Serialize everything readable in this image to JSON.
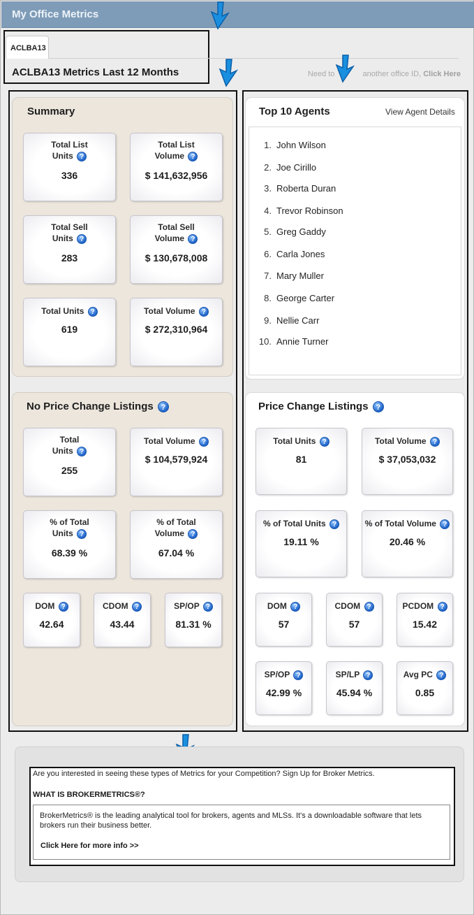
{
  "window": {
    "title": "My Office Metrics"
  },
  "tabs": [
    {
      "label": "ACLBA13"
    }
  ],
  "office": {
    "title": "ACLBA13 Metrics Last 12 Months",
    "change_prompt": "Need to",
    "change_prompt_tail": "another office ID,",
    "change_link": "Click Here"
  },
  "summary": {
    "title": "Summary",
    "cards": [
      {
        "label1": "Total List",
        "label2": "Units",
        "value": "336"
      },
      {
        "label1": "Total List",
        "label2": "Volume",
        "value": "$ 141,632,956"
      },
      {
        "label1": "Total Sell",
        "label2": "Units",
        "value": "283"
      },
      {
        "label1": "Total Sell",
        "label2": "Volume",
        "value": "$ 130,678,008"
      },
      {
        "label1": "Total Units",
        "value": "619"
      },
      {
        "label1": "Total Volume",
        "value": "$ 272,310,964"
      }
    ]
  },
  "top_agents": {
    "title": "Top 10 Agents",
    "link": "View Agent Details",
    "agents": [
      {
        "rank": "1.",
        "name": "John Wilson"
      },
      {
        "rank": "2.",
        "name": "Joe Cirillo"
      },
      {
        "rank": "3.",
        "name": "Roberta Duran"
      },
      {
        "rank": "4.",
        "name": "Trevor Robinson"
      },
      {
        "rank": "5.",
        "name": "Greg Gaddy"
      },
      {
        "rank": "6.",
        "name": "Carla Jones"
      },
      {
        "rank": "7.",
        "name": "Mary Muller"
      },
      {
        "rank": "8.",
        "name": "George Carter"
      },
      {
        "rank": "9.",
        "name": "Nellie Carr"
      },
      {
        "rank": "10.",
        "name": "Annie Turner"
      }
    ]
  },
  "no_price_change": {
    "title": "No Price Change Listings",
    "cards": [
      {
        "label1": "Total",
        "label2": "Units",
        "value": "255"
      },
      {
        "label1": "Total Volume",
        "value": "$ 104,579,924"
      },
      {
        "label1": "% of Total",
        "label2": "Units",
        "value": "68.39 %"
      },
      {
        "label1": "% of Total",
        "label2": "Volume",
        "value": "67.04 %"
      },
      {
        "label1": "DOM",
        "value": "42.64"
      },
      {
        "label1": "CDOM",
        "value": "43.44"
      },
      {
        "label1": "SP/OP",
        "value": "81.31 %"
      }
    ]
  },
  "price_change": {
    "title": "Price Change Listings",
    "cards": [
      {
        "label1": "Total Units",
        "value": "81"
      },
      {
        "label1": "Total Volume",
        "value": "$ 37,053,032"
      },
      {
        "label1": "% of Total Units",
        "value": "19.11 %"
      },
      {
        "label1": "% of Total Volume",
        "value": "20.46 %"
      },
      {
        "label1": "DOM",
        "value": "57"
      },
      {
        "label1": "CDOM",
        "value": "57"
      },
      {
        "label1": "PCDOM",
        "value": "15.42"
      },
      {
        "label1": "SP/OP",
        "value": "42.99 %"
      },
      {
        "label1": "SP/LP",
        "value": "45.94 %"
      },
      {
        "label1": "Avg PC",
        "value": "0.85"
      }
    ]
  },
  "footer": {
    "question": "Are you interested in seeing these types of Metrics for your Competition? Sign Up for Broker Metrics.",
    "heading": "WHAT IS BROKERMETRICS®?",
    "description": "BrokerMetrics® is the leading analytical tool for brokers, agents and MLSs. It's a downloadable software that lets brokers run their business better.",
    "link": "Click Here for more info >>"
  },
  "icons": {
    "help": "question-mark-icon",
    "annotation": "annotation-arrow-icon"
  },
  "colors": {
    "header": "#7e9cb8",
    "panel_beige": "#ece6dd",
    "help_icon": "#1f64c9",
    "annotation_arrow": "#1a8fe0"
  }
}
